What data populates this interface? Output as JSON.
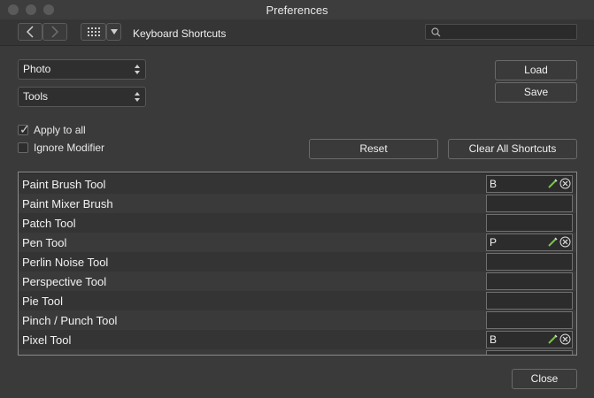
{
  "window": {
    "title": "Preferences"
  },
  "toolbar": {
    "section_title": "Keyboard Shortcuts",
    "search_placeholder": ""
  },
  "selects": {
    "application": "Photo",
    "category": "Tools"
  },
  "buttons": {
    "load": "Load",
    "save": "Save",
    "reset": "Reset",
    "clear_all": "Clear All Shortcuts",
    "close": "Close"
  },
  "options": {
    "apply_to_all": {
      "label": "Apply to all",
      "checked": true
    },
    "ignore_modifier": {
      "label": "Ignore Modifier",
      "checked": false
    }
  },
  "shortcuts": [
    {
      "name": "Paint Brush Tool",
      "key": "B"
    },
    {
      "name": "Paint Mixer Brush",
      "key": ""
    },
    {
      "name": "Patch Tool",
      "key": ""
    },
    {
      "name": "Pen Tool",
      "key": "P"
    },
    {
      "name": "Perlin Noise Tool",
      "key": ""
    },
    {
      "name": "Perspective Tool",
      "key": ""
    },
    {
      "name": "Pie Tool",
      "key": ""
    },
    {
      "name": "Pinch / Punch Tool",
      "key": ""
    },
    {
      "name": "Pixel Tool",
      "key": "B"
    }
  ],
  "colors": {
    "window_bg": "#3a3a3a",
    "accent_pen": "#7cc24a"
  }
}
